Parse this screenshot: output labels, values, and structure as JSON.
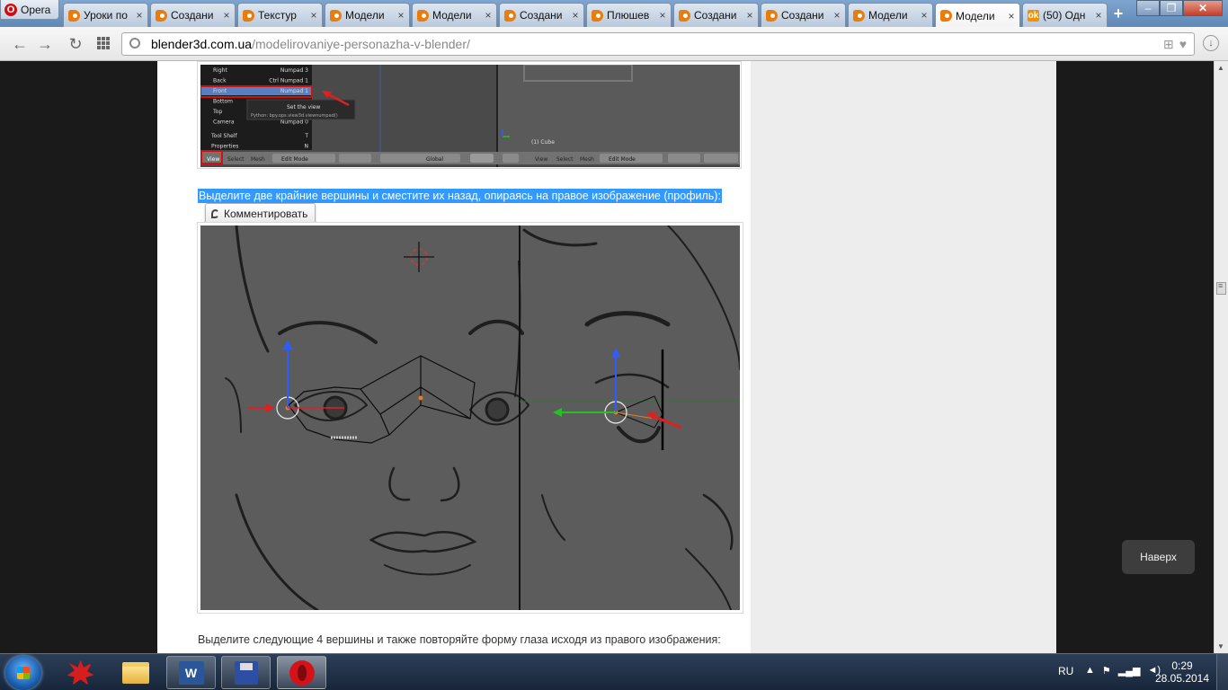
{
  "browser": {
    "menu_label": "Opera",
    "tabs": [
      {
        "label": "Уроки по",
        "icon": "blender"
      },
      {
        "label": "Создани",
        "icon": "blender"
      },
      {
        "label": "Текстур",
        "icon": "blender"
      },
      {
        "label": "Модели",
        "icon": "blender"
      },
      {
        "label": "Модели",
        "icon": "blender"
      },
      {
        "label": "Создани",
        "icon": "blender"
      },
      {
        "label": "Плюшев",
        "icon": "blender"
      },
      {
        "label": "Создани",
        "icon": "blender"
      },
      {
        "label": "Создани",
        "icon": "blender"
      },
      {
        "label": "Модели",
        "icon": "blender"
      },
      {
        "label": "Модели",
        "icon": "blender",
        "active": true
      },
      {
        "label": "(50) Одн",
        "icon": "odnoklassniki"
      }
    ],
    "new_tab": "+",
    "url_domain": "blender3d.com.ua",
    "url_path": "/modelirovaniye-personazha-v-blender/"
  },
  "page": {
    "selected_paragraph": "Выделите две крайние вершины и сместите их назад, опираясь на правое изображение (профиль):",
    "comment_button": "Комментировать",
    "next_paragraph": "Выделите следующие 4 вершины и также повторяйте форму глаза исходя из правого изображения:",
    "back_to_top": "Наверх",
    "menu_screenshot": {
      "items": [
        {
          "label": "Right",
          "shortcut": "Numpad 3"
        },
        {
          "label": "Back",
          "shortcut": "Ctrl Numpad 1"
        },
        {
          "label": "Front",
          "shortcut": "Numpad 1"
        },
        {
          "label": "Bottom",
          "shortcut": ""
        },
        {
          "label": "Top",
          "shortcut": ""
        },
        {
          "label": "Camera",
          "shortcut": "Numpad 0"
        },
        {
          "label": "Tool Shelf",
          "shortcut": "T"
        },
        {
          "label": "Properties",
          "shortcut": "N"
        }
      ],
      "tooltip_title": "Set the view",
      "tooltip_python": "Python: bpy.ops.view3d.viewnumpad()",
      "left_header": [
        "View",
        "Select",
        "Mesh",
        "Edit Mode",
        "Global"
      ],
      "right_header": [
        "View",
        "Select",
        "Mesh",
        "Edit Mode"
      ],
      "object_label": "(1) Cube"
    }
  },
  "taskbar": {
    "language": "RU",
    "time": "0:29",
    "date": "28.05.2014"
  },
  "colors": {
    "selection": "#3399ff",
    "viewport_bg": "#555555",
    "arrow_red": "#e02020",
    "axis_blue": "#2f5cff",
    "axis_green": "#26c026"
  }
}
